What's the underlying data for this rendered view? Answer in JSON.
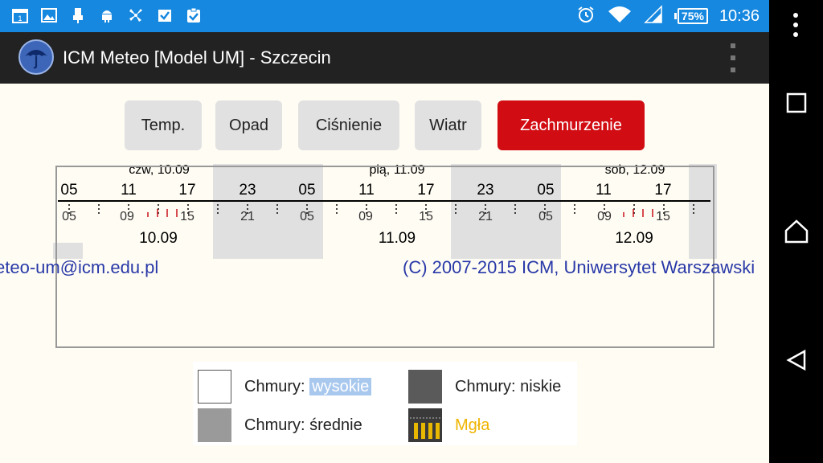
{
  "status_bar": {
    "notification_icons": [
      "calendar-icon",
      "image-icon",
      "usb-icon",
      "android-debug-icon",
      "windmill-icon",
      "task-check-icon",
      "clipboard-check-icon"
    ],
    "battery": "75%",
    "time": "10:36"
  },
  "app_bar": {
    "title": "ICM Meteo [Model UM] - Szczecin"
  },
  "tabs": [
    {
      "label": "Temp.",
      "active": false
    },
    {
      "label": "Opad",
      "active": false
    },
    {
      "label": "Ciśnienie",
      "active": false
    },
    {
      "label": "Wiatr",
      "active": false
    },
    {
      "label": "Zachmurzenie",
      "active": true
    }
  ],
  "chart": {
    "day_headers": [
      "czw, 10.09",
      "pią, 11.09",
      "sob, 12.09"
    ],
    "top_hour_labels": [
      "05",
      "11",
      "17",
      "23",
      "05",
      "11",
      "17",
      "23",
      "05",
      "11",
      "17"
    ],
    "bottom_hour_labels": [
      "05",
      "09",
      "15",
      "21",
      "05",
      "09",
      "15",
      "21",
      "05",
      "09",
      "15"
    ],
    "dates": [
      "10.09",
      "11.09",
      "12.09"
    ]
  },
  "footer": {
    "email": "eteo-um@icm.edu.pl",
    "copyright": "(C) 2007-2015 ICM, Uniwersytet Warszawski"
  },
  "legend": {
    "high_label": "Chmury: ",
    "high_value": "wysokie",
    "low": "Chmury: niskie",
    "mid": "Chmury: średnie",
    "fog": "Mgła",
    "colors": {
      "high": "#ffffff",
      "mid": "#9a9a9a",
      "low": "#5a5a5a",
      "fog_text": "#f0b400",
      "fog_bars": "#e8b800"
    }
  },
  "colors": {
    "status_bar": "#1688e0",
    "action_bar": "#222222",
    "active_tab": "#d10d13",
    "link_text": "#2838a8"
  }
}
